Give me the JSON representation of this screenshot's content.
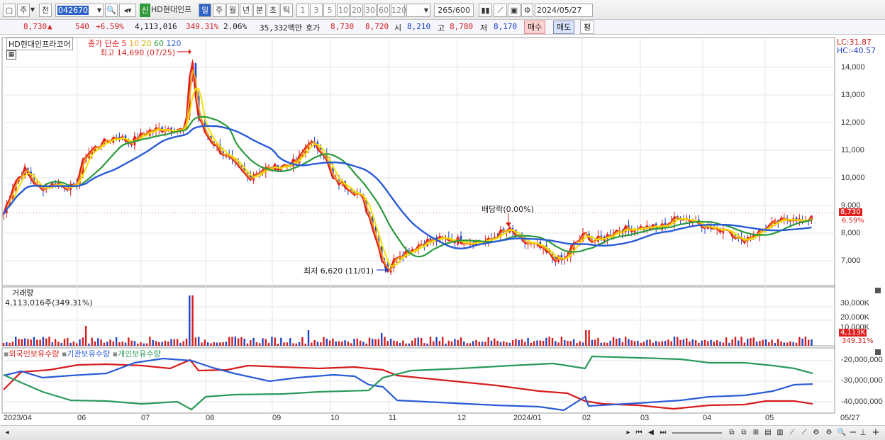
{
  "toolbar": {
    "market": "주",
    "type": "전",
    "code": "042670",
    "new_badge": "신",
    "stock_name": "HD현대인프",
    "periods": [
      "일",
      "주",
      "월",
      "년",
      "분",
      "초",
      "틱"
    ],
    "active_period": "일",
    "intervals": [
      "1",
      "3",
      "5",
      "10",
      "20",
      "30",
      "60",
      "120"
    ],
    "count": "265",
    "count_total": "/600",
    "date": "2024/05/27"
  },
  "quote": {
    "price": "8,730",
    "change": "540",
    "change_pct": "+6.59%",
    "volume": "4,113,016",
    "volume_ratio": "349.31%",
    "turnover": "2.06%",
    "amount": "35,332백만",
    "bid_label": "호가",
    "ask": "8,730",
    "bid": "8,720",
    "open_label": "시",
    "open": "8,210",
    "high_label": "고",
    "high": "8,780",
    "low_label": "저",
    "low": "8,170",
    "buy_label": "매수",
    "sell_label": "매도",
    "avg_label": "평"
  },
  "price_panel": {
    "stock_tag": "HD현대인프라코어",
    "ma_label": "종가 단순",
    "ma_periods": [
      {
        "label": "5",
        "color": "#e41a1a"
      },
      {
        "label": "10",
        "color": "#f0a020"
      },
      {
        "label": "20",
        "color": "#e8d400"
      },
      {
        "label": "60",
        "color": "#2a9a3a"
      },
      {
        "label": "120",
        "color": "#2a5bd7"
      }
    ],
    "lc": "LC:31.87",
    "hc": "HC:-40.57",
    "high_note": "최고 14,690 (07/25)",
    "low_note": "최저 6,620 (11/01)",
    "dividend_note": "배당락(0.00%)",
    "last_price_tag": "8,730",
    "last_pct_tag": "6.59%",
    "y_ticks": [
      "14,000",
      "13,000",
      "12,000",
      "11,000",
      "10,000",
      "9,000",
      "8,000",
      "7,000"
    ]
  },
  "volume_panel": {
    "title": "거래량",
    "value": "4,113,016주(349.31%)",
    "y_ticks": [
      "30,000K",
      "20,000K",
      "10,000K"
    ],
    "last_tag": "4,113K",
    "last_pct": "349.31%"
  },
  "holdings_panel": {
    "series": [
      {
        "label": "외국인보유수량",
        "color": "#d61c1c"
      },
      {
        "label": "기관보유수량",
        "color": "#2a5bd7"
      },
      {
        "label": "개인보유수량",
        "color": "#2a9a5a"
      }
    ],
    "y_ticks": [
      "-20,000,000",
      "-30,000,000",
      "-40,000,000"
    ]
  },
  "x_axis": [
    "2023/04",
    "06",
    "07",
    "08",
    "09",
    "10",
    "11",
    "12",
    "2024/01",
    "02",
    "03",
    "04",
    "05",
    "05/27"
  ],
  "chart_data": {
    "type": "line",
    "title": "HD현대인프라코어",
    "ylim": [
      6500,
      14700
    ],
    "price_close_approx": [
      {
        "x": "2023/04",
        "y": 8700
      },
      {
        "x": "05",
        "y": 10300
      },
      {
        "x": "06",
        "y": 11500
      },
      {
        "x": "07",
        "y": 12000
      },
      {
        "x": "07/25",
        "y": 14690
      },
      {
        "x": "08",
        "y": 11000
      },
      {
        "x": "09",
        "y": 10300
      },
      {
        "x": "09/end",
        "y": 11500
      },
      {
        "x": "10",
        "y": 9800
      },
      {
        "x": "11/01",
        "y": 6620
      },
      {
        "x": "12",
        "y": 7800
      },
      {
        "x": "2024/01",
        "y": 8000
      },
      {
        "x": "02",
        "y": 7800
      },
      {
        "x": "03",
        "y": 8200
      },
      {
        "x": "04",
        "y": 8000
      },
      {
        "x": "05",
        "y": 8400
      },
      {
        "x": "05/27",
        "y": 8730
      }
    ]
  }
}
